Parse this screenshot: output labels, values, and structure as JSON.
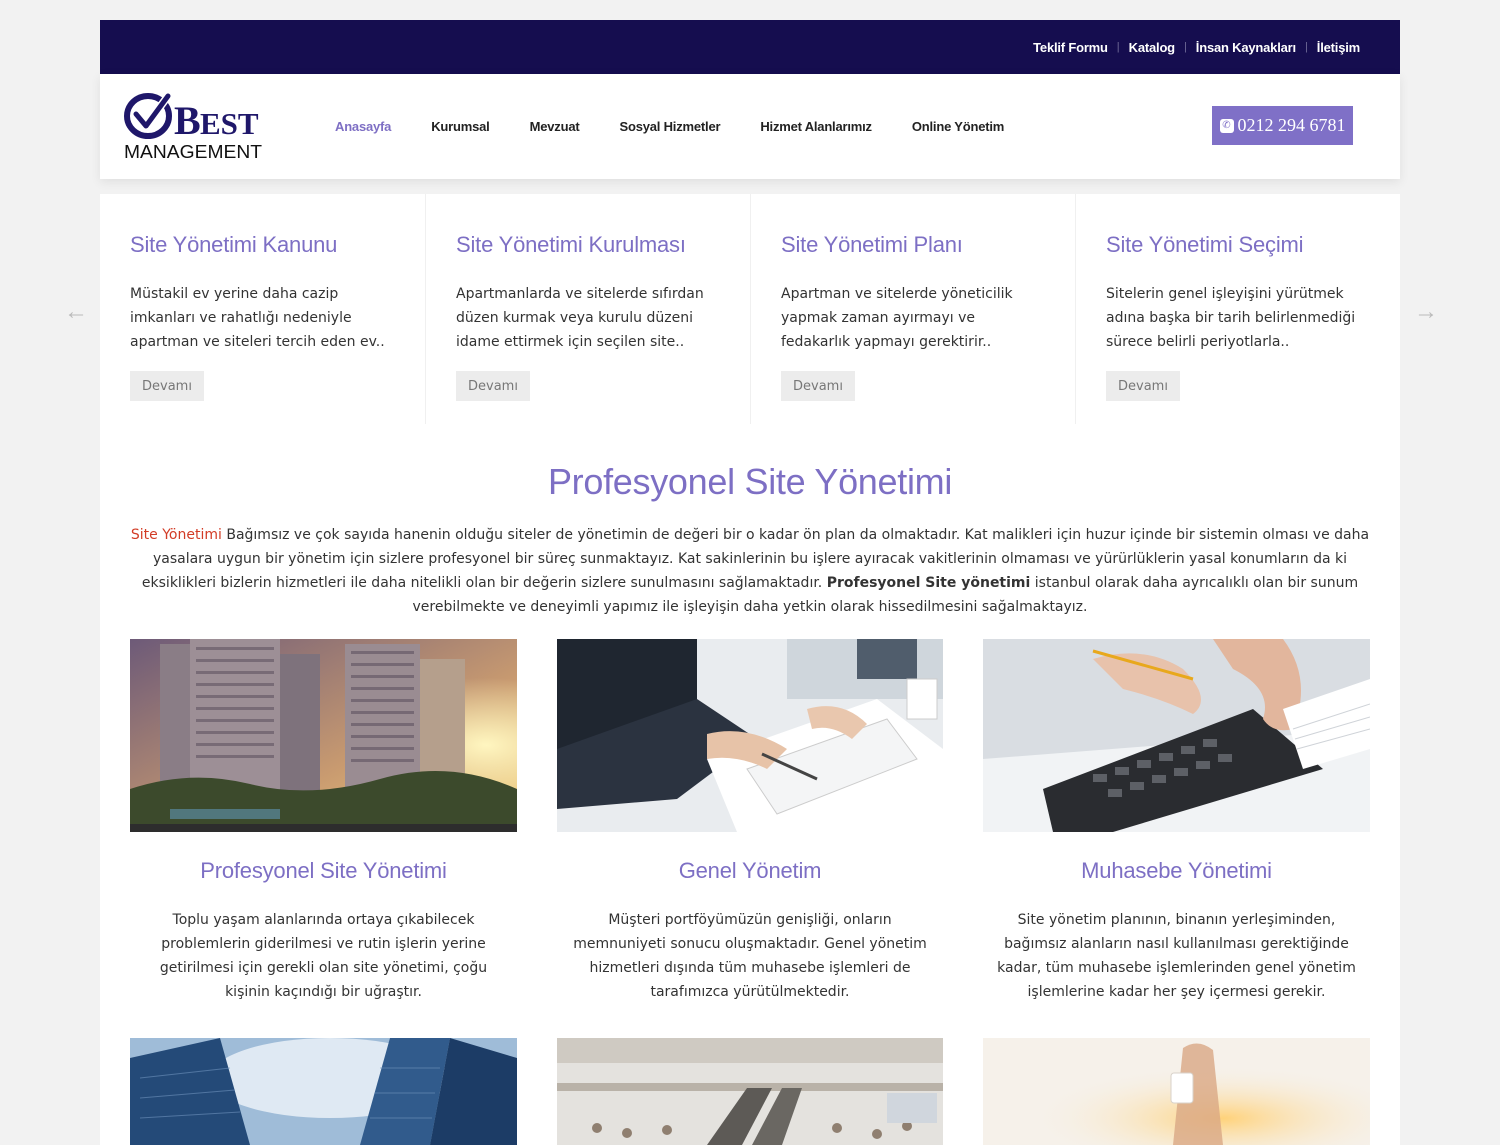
{
  "topbar": {
    "links": [
      "Teklif Formu",
      "Katalog",
      "İnsan Kaynakları",
      "İletişim"
    ]
  },
  "logo": {
    "word": "BEST",
    "sub": "MANAGEMENT"
  },
  "nav": {
    "items": [
      "Anasayfa",
      "Kurumsal",
      "Mevzuat",
      "Sosyal Hizmetler",
      "Hizmet Alanlarımız",
      "Online Yönetim"
    ],
    "active": "Anasayfa"
  },
  "phone": {
    "number": "0212 294 6781",
    "icon": "phone-icon"
  },
  "slider": {
    "items": [
      {
        "title": "Site Yönetimi Kanunu",
        "text": "Müstakil ev yerine daha cazip imkanları ve rahatlığı nedeniyle apartman ve siteleri tercih eden ev..",
        "button": "Devamı"
      },
      {
        "title": "Site Yönetimi Kurulması",
        "text": "Apartmanlarda ve sitelerde sıfırdan düzen kurmak veya kurulu düzeni idame ettirmek için seçilen site..",
        "button": "Devamı"
      },
      {
        "title": "Site Yönetimi Planı",
        "text": "Apartman ve sitelerde yöneticilik yapmak zaman ayırmayı ve fedakarlık yapmayı gerektirir..",
        "button": "Devamı"
      },
      {
        "title": "Site Yönetimi Seçimi",
        "text": "Sitelerin genel işleyişini yürütmek adına başka bir tarih belirlenmediği sürece belirli periyotlarla..",
        "button": "Devamı"
      }
    ],
    "prev_icon": "arrow-left-icon",
    "next_icon": "arrow-right-icon"
  },
  "main": {
    "title": "Profesyonel Site Yönetimi",
    "intro_link": "Site Yönetimi",
    "intro_part1": " Bağımsız ve çok sayıda hanenin olduğu siteler de yönetimin de değeri bir o kadar ön plan da olmaktadır. Kat malikleri için huzur içinde bir sistemin olması ve daha yasalara uygun bir yönetim için sizlere profesyonel bir süreç sunmaktayız. Kat sakinlerinin bu işlere ayıracak vakitlerinin olmaması ve yürürlüklerin yasal konumların da ki eksiklikleri bizlerin hizmetleri ile daha nitelikli olan bir değerin sizlere sunulmasını sağlamaktadır. ",
    "intro_bold": "Profesyonel Site yönetimi",
    "intro_part2": " istanbul olarak daha ayrıcalıklı olan bir sunum verebilmekte ve deneyimli yapımız ile işleyişin daha yetkin olarak hissedilmesini sağalmaktayız."
  },
  "cards": [
    {
      "title": "Profesyonel Site Yönetimi",
      "text": "Toplu yaşam alanlarında ortaya çıkabilecek problemlerin giderilmesi ve rutin işlerin yerine getirilmesi için gerekli olan site yönetimi, çoğu kişinin kaçındığı bir uğraştır."
    },
    {
      "title": "Genel Yönetim",
      "text": "Müşteri portföyümüzün genişliği, onların memnuniyeti sonucu oluşmaktadır. Genel yönetim hizmetleri dışında tüm muhasebe işlemleri de tarafımızca yürütülmektedir."
    },
    {
      "title": "Muhasebe Yönetimi",
      "text": "Site yönetim planının, binanın yerleşiminden, bağımsız alanların nasıl kullanılması gerektiğinde kadar, tüm muhasebe işlemlerinden genel yönetim işlemlerine kadar her şey içermesi gerekir."
    }
  ],
  "colors": {
    "brand_dark": "#150d4f",
    "accent": "#7d6fc4",
    "link_red": "#d23c26"
  }
}
